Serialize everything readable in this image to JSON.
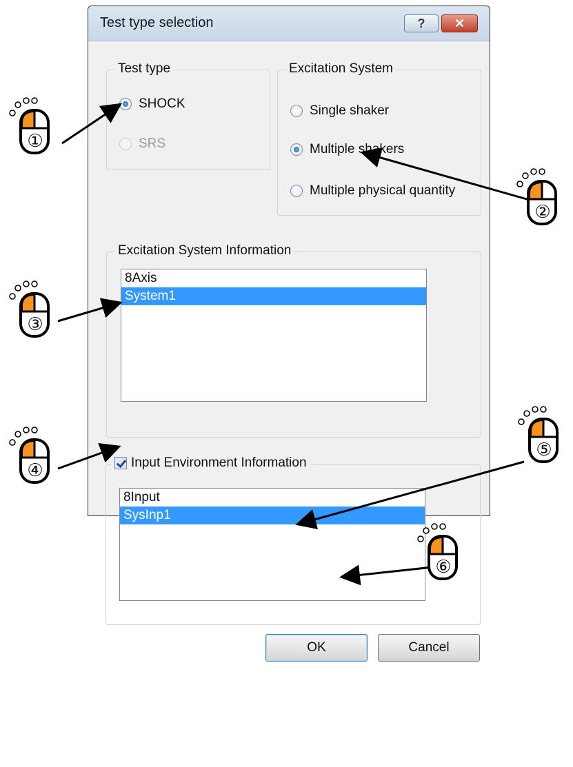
{
  "dialog": {
    "title": "Test type selection",
    "help_icon": "help-icon",
    "close_icon": "close-icon"
  },
  "test_type": {
    "label": "Test type",
    "options": [
      {
        "label": "SHOCK",
        "selected": true,
        "enabled": true
      },
      {
        "label": "SRS",
        "selected": false,
        "enabled": false
      }
    ]
  },
  "excitation_system": {
    "label": "Excitation System",
    "options": [
      {
        "label": "Single shaker",
        "selected": false
      },
      {
        "label": "Multiple shakers",
        "selected": true
      },
      {
        "label": "Multiple physical quantity",
        "selected": false
      }
    ]
  },
  "excitation_info": {
    "label": "Excitation System Information",
    "items": [
      "8Axis",
      "System1"
    ],
    "selected_index": 1
  },
  "input_env": {
    "label": "Input Environment Information",
    "checked": true,
    "items": [
      "8Input",
      "SysInp1"
    ],
    "selected_index": 1
  },
  "buttons": {
    "ok": "OK",
    "cancel": "Cancel"
  },
  "annotations": [
    "①",
    "②",
    "③",
    "④",
    "⑤",
    "⑥"
  ],
  "colors": {
    "selection": "#3399ff",
    "mouse_button": "#f7941d"
  }
}
